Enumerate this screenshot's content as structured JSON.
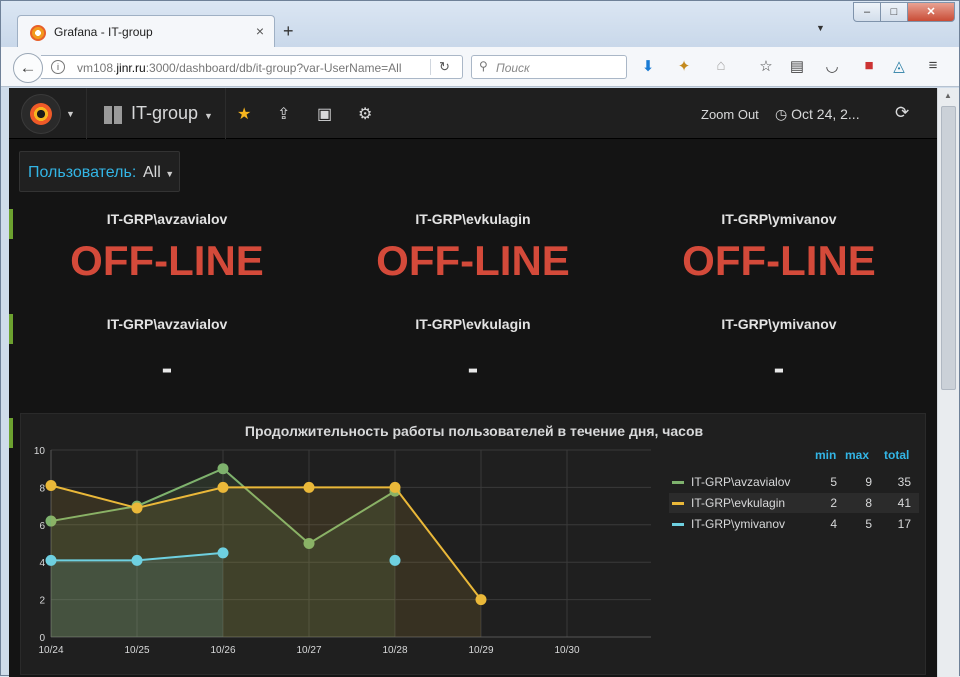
{
  "browser": {
    "tab_title": "Grafana - IT-group",
    "url_prefix": "vm108.",
    "url_host": "jinr.ru",
    "url_suffix": ":3000/dashboard/db/it-group?var-UserName=All",
    "search_placeholder": "Поиск",
    "new_tab_label": "+",
    "close_tab_label": "×"
  },
  "grafana": {
    "dashboard_title": "IT-group",
    "zoom_out_label": "Zoom Out",
    "time_range_label": "Oct 24, 2...",
    "variable": {
      "label": "Пользователь:",
      "value": "All"
    },
    "status_row": [
      {
        "user": "IT-GRP\\avzavialov",
        "value": "OFF-LINE"
      },
      {
        "user": "IT-GRP\\evkulagin",
        "value": "OFF-LINE"
      },
      {
        "user": "IT-GRP\\ymivanov",
        "value": "OFF-LINE"
      }
    ],
    "value_row": [
      {
        "user": "IT-GRP\\avzavialov",
        "value": "-"
      },
      {
        "user": "IT-GRP\\evkulagin",
        "value": "-"
      },
      {
        "user": "IT-GRP\\ymivanov",
        "value": "-"
      }
    ]
  },
  "colors": {
    "series_avzavialov": "#7eb26d",
    "series_evkulagin": "#eab839",
    "series_ymivanov": "#6ed0e0",
    "offline": "#d44a3a",
    "variable_label": "#33b5e5",
    "row_marker": "#6ca12f"
  },
  "chart_data": {
    "type": "line",
    "title": "Продолжительность работы пользователей в течение дня, часов",
    "x": [
      "10/24",
      "10/25",
      "10/26",
      "10/27",
      "10/28",
      "10/29",
      "10/30"
    ],
    "ylim": [
      0,
      10
    ],
    "yticks": [
      0,
      2,
      4,
      6,
      8,
      10
    ],
    "grid": true,
    "legend_placement": "right",
    "legend_columns": [
      "min",
      "max",
      "total"
    ],
    "series": [
      {
        "name": "IT-GRP\\avzavialov",
        "values": [
          6.2,
          7,
          9,
          5,
          7.8,
          null,
          null
        ],
        "min": "5",
        "max": "9",
        "total": "35",
        "color": "#7eb26d"
      },
      {
        "name": "IT-GRP\\evkulagin",
        "values": [
          8.1,
          6.9,
          8,
          8,
          8,
          2,
          null
        ],
        "min": "2",
        "max": "8",
        "total": "41",
        "color": "#eab839"
      },
      {
        "name": "IT-GRP\\ymivanov",
        "values": [
          4.1,
          4.1,
          4.5,
          null,
          4.1,
          null,
          null
        ],
        "min": "4",
        "max": "5",
        "total": "17",
        "color": "#6ed0e0"
      }
    ]
  }
}
